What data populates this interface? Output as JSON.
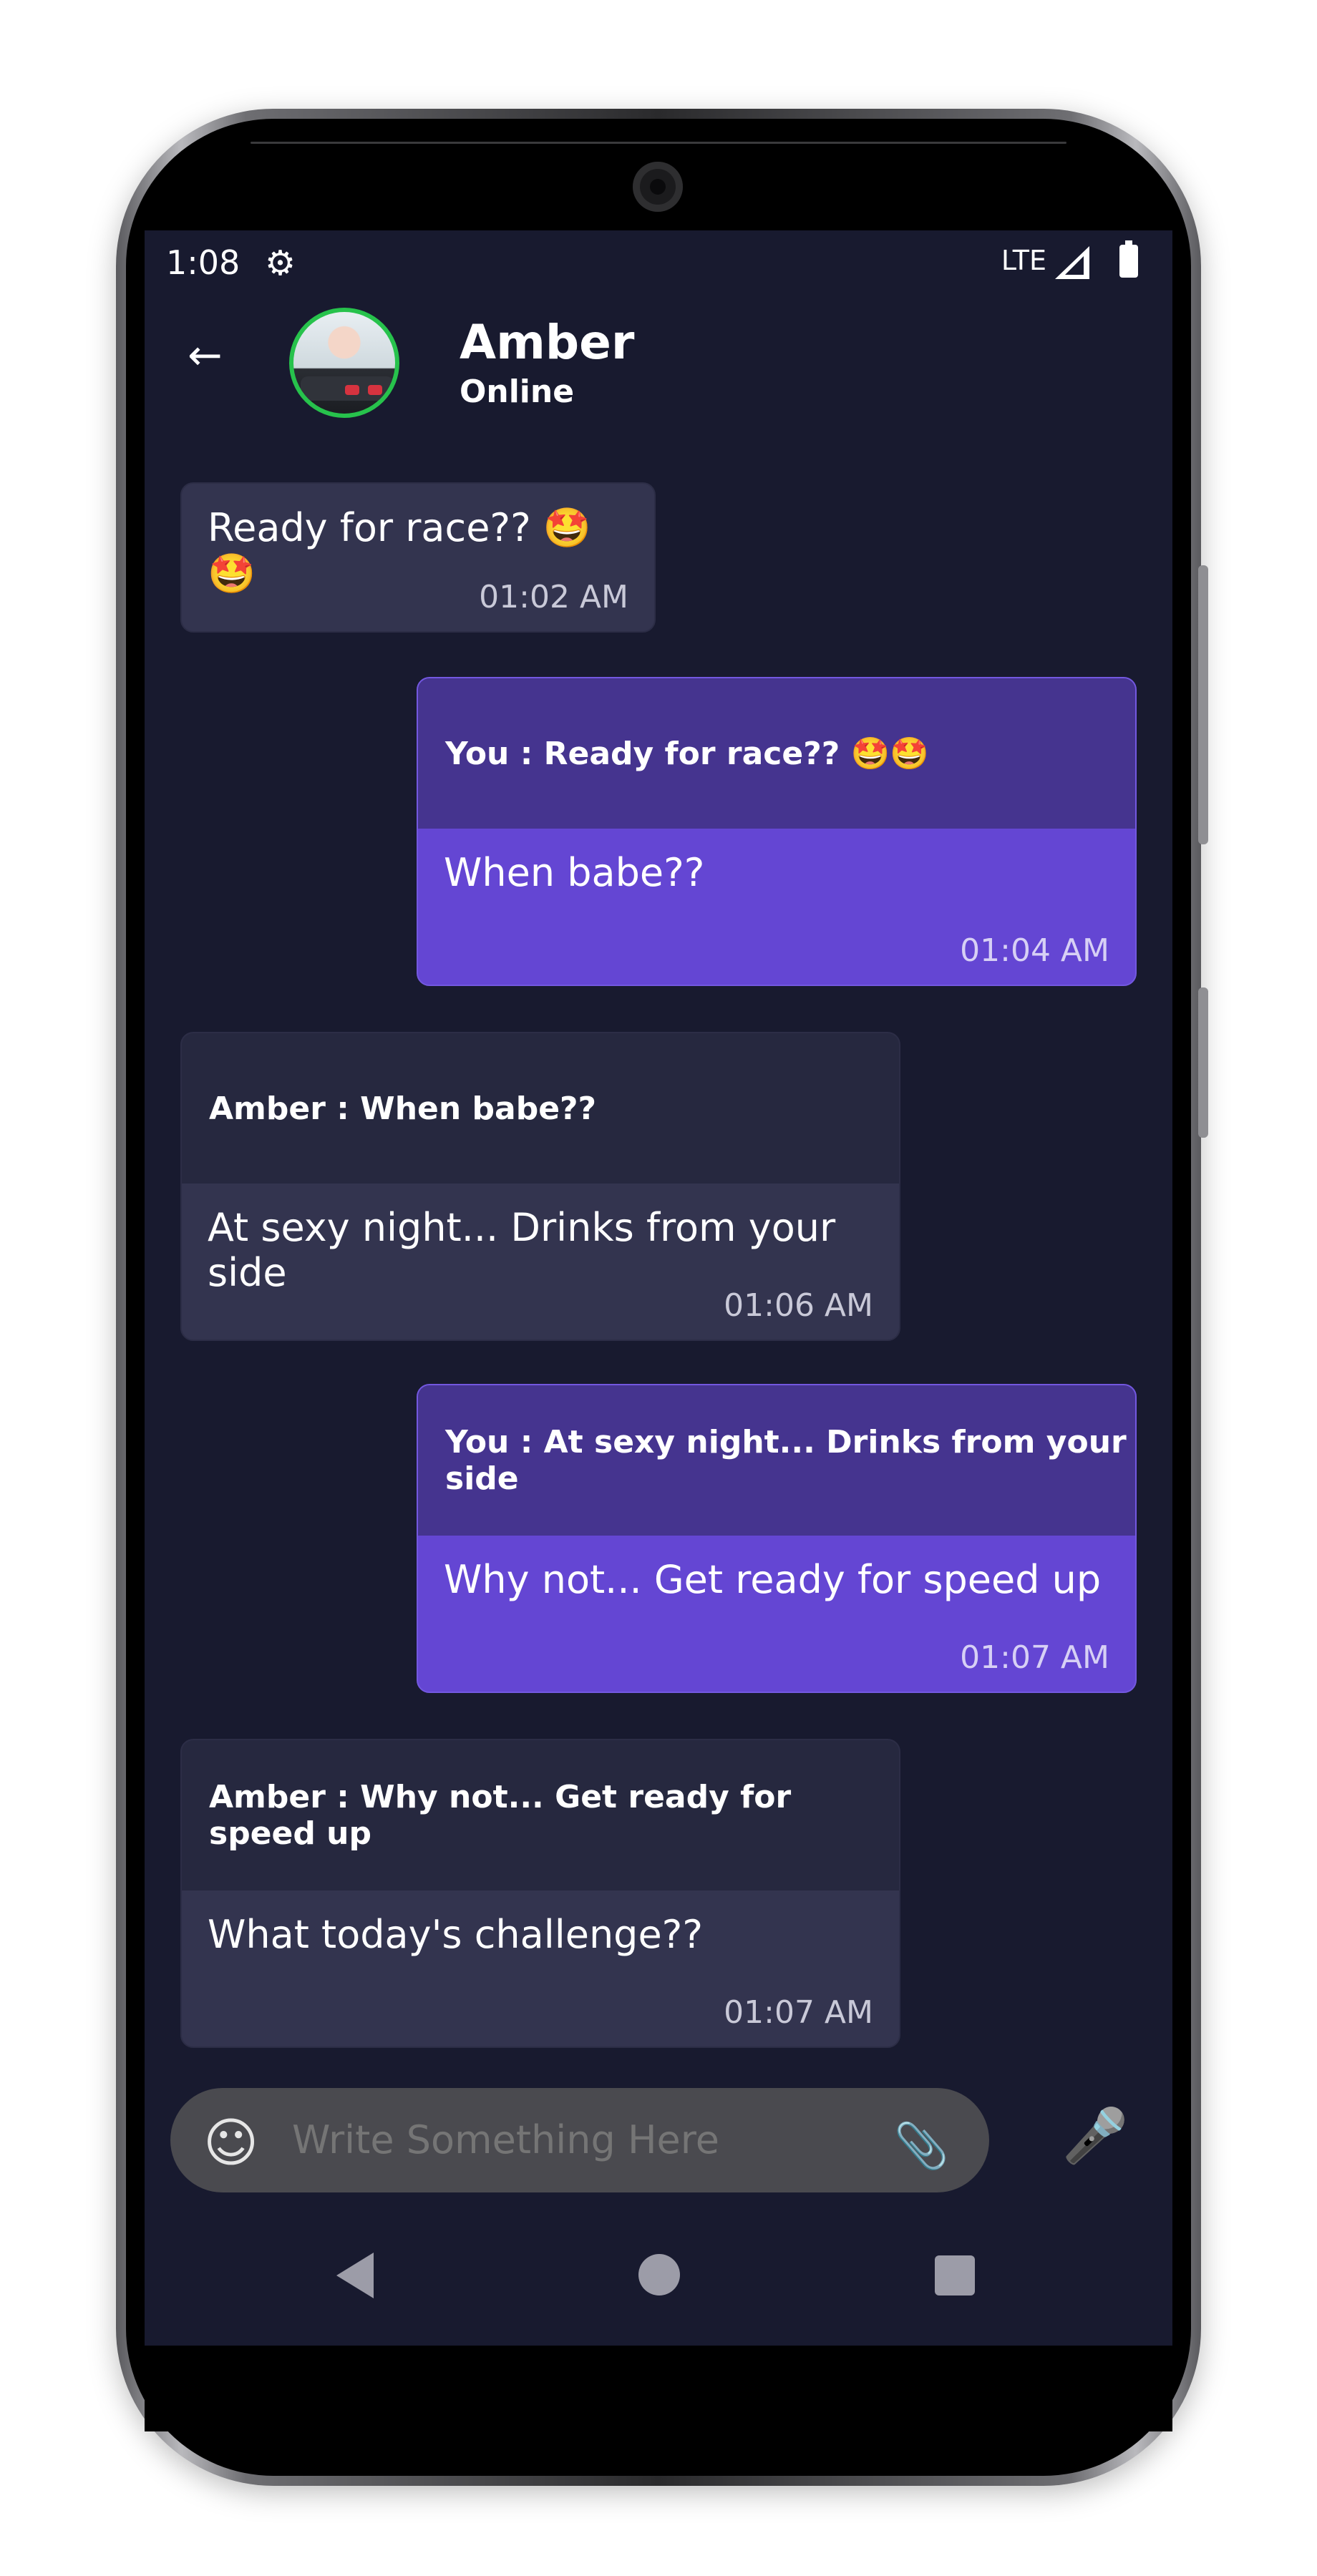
{
  "status_bar": {
    "time": "1:08",
    "network": "LTE"
  },
  "header": {
    "name": "Amber",
    "status": "Online"
  },
  "messages": [
    {
      "text": "Ready for race?? 🤩🤩",
      "time": "01:02 AM"
    },
    {
      "quote": "You : Ready for race?? 🤩🤩",
      "text": "When babe??",
      "time": "01:04 AM"
    },
    {
      "quote": "Amber : When babe??",
      "text": "At sexy night... Drinks from your side",
      "time": "01:06 AM"
    },
    {
      "quote": "You : At sexy night... Drinks from your side",
      "text": "Why not... Get ready for speed up",
      "time": "01:07 AM"
    },
    {
      "quote": "Amber : Why not... Get ready for speed up",
      "text": "What today's challenge??",
      "time": "01:07 AM"
    }
  ],
  "composer": {
    "placeholder": "Write Something Here"
  },
  "icons": {
    "settings": "gear-icon",
    "back": "arrow-left-icon",
    "emoji": "smiley-icon",
    "attach": "paperclip-icon",
    "mic": "microphone-icon"
  },
  "colors": {
    "background": "#181a2f",
    "incoming_bubble": "#33344f",
    "outgoing_bubble": "#6446d3",
    "online_ring": "#27c24c"
  }
}
